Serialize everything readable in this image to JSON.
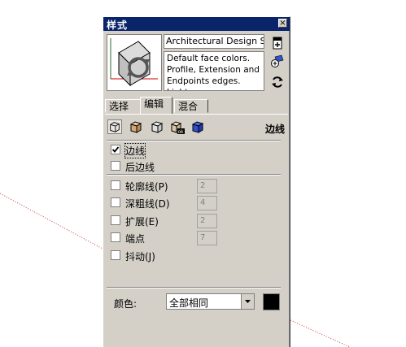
{
  "window": {
    "title": "样式",
    "close_glyph": "×"
  },
  "style": {
    "name": "Architectural Design Style",
    "description": "Default face colors. Profile, Extension and Endpoints edges. Light"
  },
  "tabs": [
    {
      "label": "选择",
      "active": false
    },
    {
      "label": "编辑",
      "active": true
    },
    {
      "label": "混合",
      "active": false
    }
  ],
  "section_title": "边线",
  "options": {
    "edges": {
      "label": "边线",
      "checked": true
    },
    "back_edges": {
      "label": "后边线",
      "checked": false
    },
    "profiles": {
      "label": "轮廓线(P)",
      "checked": false,
      "value": "2"
    },
    "depth_cue": {
      "label": "深粗线(D)",
      "checked": false,
      "value": "4"
    },
    "extension": {
      "label": "扩展(E)",
      "checked": false,
      "value": "2"
    },
    "endpoints": {
      "label": "端点",
      "checked": false,
      "value": "7"
    },
    "jitter": {
      "label": "抖动(J)",
      "checked": false
    }
  },
  "color": {
    "label": "颜色:",
    "selected": "全部相同",
    "swatch": "#000000"
  },
  "colors": {
    "titlebar": "#0a246a",
    "panel": "#d4d0c8",
    "guide_line": "#cc3333"
  }
}
